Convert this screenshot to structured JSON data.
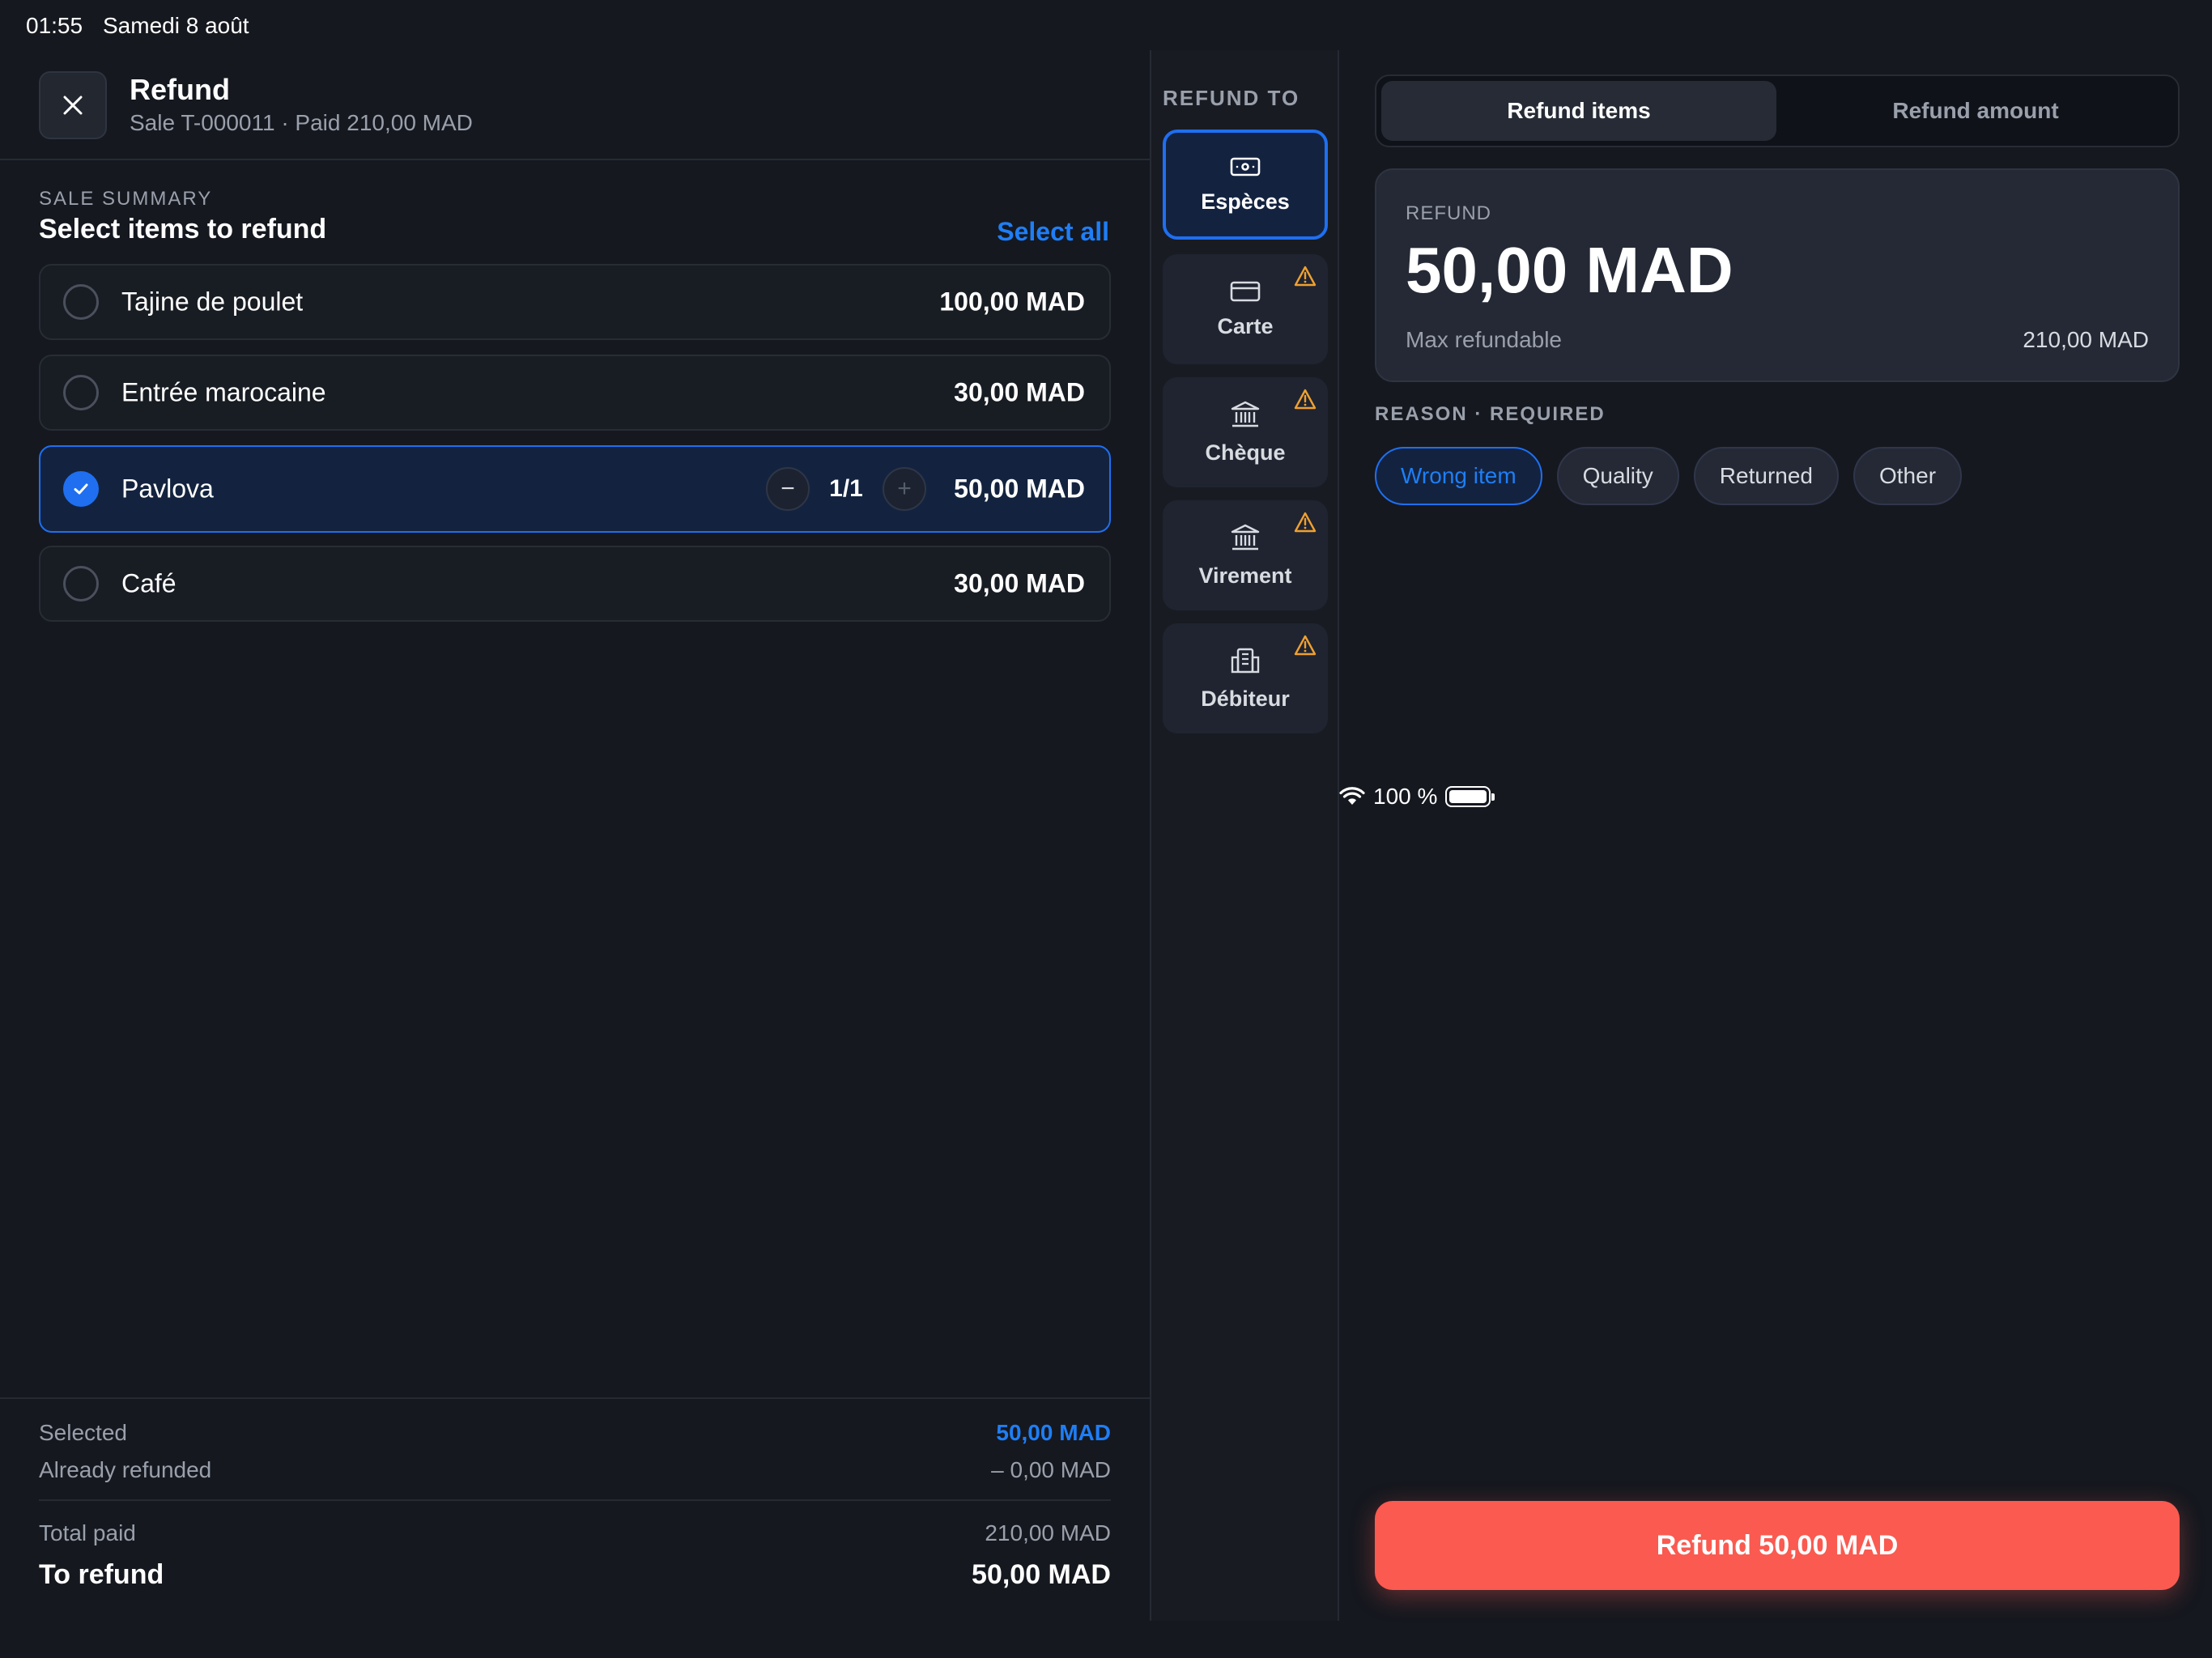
{
  "status": {
    "time": "01:55",
    "date": "Samedi 8 août",
    "battery": "100 %"
  },
  "header": {
    "title": "Refund",
    "subtitle": "Sale T-000011 · Paid 210,00 MAD"
  },
  "summary": {
    "label": "SALE SUMMARY",
    "title": "Select items to refund",
    "select_all": "Select all",
    "items": [
      {
        "name": "Tajine de poulet",
        "price": "100,00 MAD",
        "selected": false
      },
      {
        "name": "Entrée marocaine",
        "price": "30,00 MAD",
        "selected": false
      },
      {
        "name": "Pavlova",
        "price": "50,00 MAD",
        "selected": true,
        "qty": "1/1"
      },
      {
        "name": "Café",
        "price": "30,00 MAD",
        "selected": false
      }
    ]
  },
  "footer": {
    "selected_label": "Selected",
    "selected_value": "50,00 MAD",
    "already_label": "Already refunded",
    "already_value": "– 0,00 MAD",
    "total_label": "Total paid",
    "total_value": "210,00 MAD",
    "torefund_label": "To refund",
    "torefund_value": "50,00 MAD"
  },
  "refund_to": {
    "label": "REFUND TO",
    "methods": [
      {
        "label": "Espèces",
        "icon": "cash-icon",
        "active": true,
        "warning": false
      },
      {
        "label": "Carte",
        "icon": "card-icon",
        "active": false,
        "warning": true
      },
      {
        "label": "Chèque",
        "icon": "bank-icon",
        "active": false,
        "warning": true
      },
      {
        "label": "Virement",
        "icon": "bank-icon",
        "active": false,
        "warning": true
      },
      {
        "label": "Débiteur",
        "icon": "building-icon",
        "active": false,
        "warning": true
      }
    ]
  },
  "tabs": {
    "items": "Refund items",
    "amount": "Refund amount"
  },
  "refund_card": {
    "label": "REFUND",
    "amount": "50,00 MAD",
    "max_label": "Max refundable",
    "max_value": "210,00 MAD"
  },
  "reason": {
    "label": "REASON · REQUIRED",
    "options": [
      "Wrong item",
      "Quality",
      "Returned",
      "Other"
    ],
    "selected": "Wrong item"
  },
  "cta": {
    "label": "Refund 50,00 MAD"
  },
  "colors": {
    "accent": "#1f6ff0",
    "cta": "#fa5a50",
    "warning": "#f0a030"
  }
}
